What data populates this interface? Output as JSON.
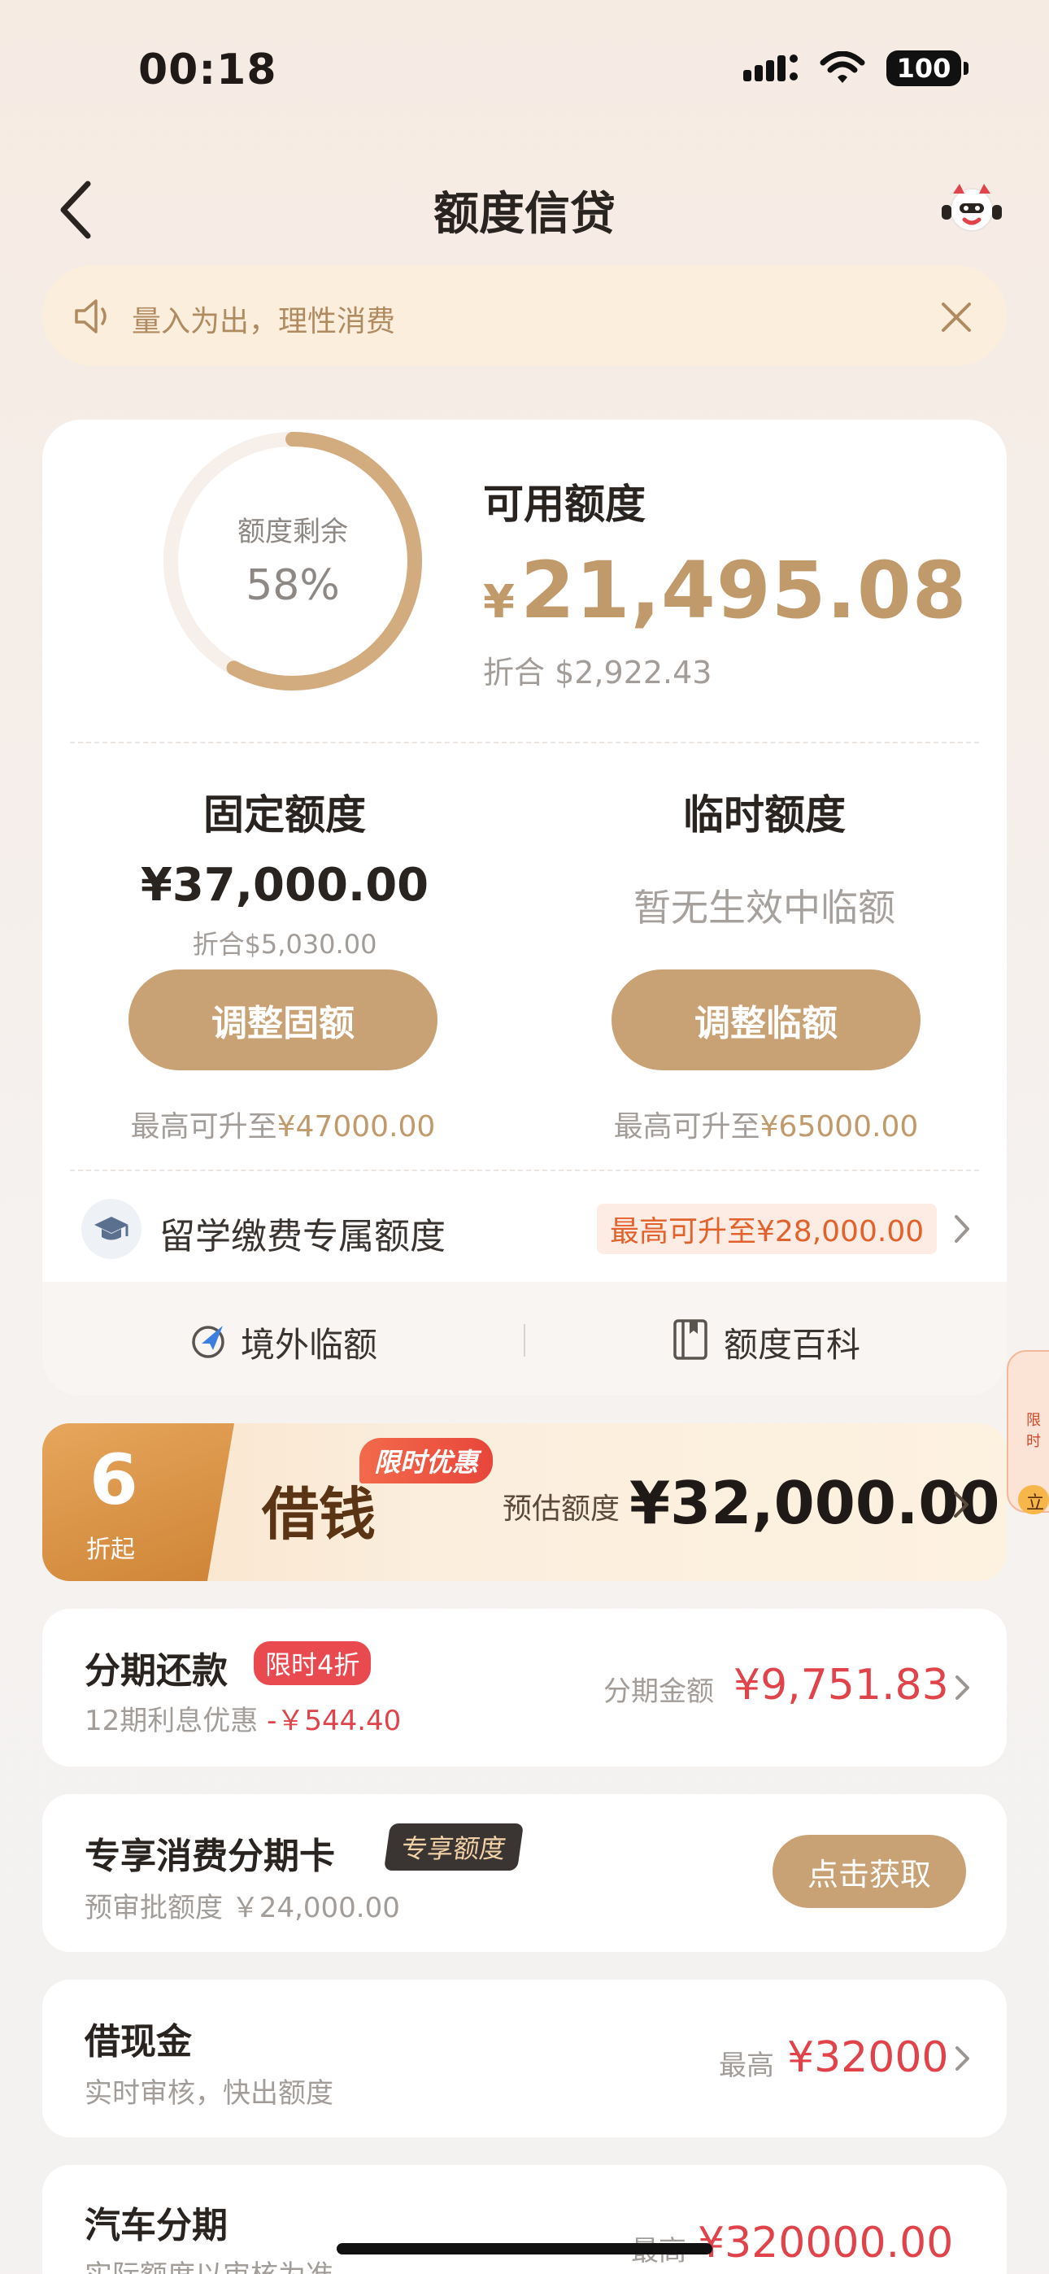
{
  "status_bar": {
    "time": "00:18",
    "battery": "100"
  },
  "nav": {
    "title": "额度信贷",
    "back_icon": "chevron-left-icon",
    "mascot_icon": "mascot-icon"
  },
  "notice": {
    "text": "量入为出，理性消费"
  },
  "credit": {
    "ring_label": "额度剩余",
    "ring_percent": "58%",
    "remaining_fraction": 0.58,
    "available_label": "可用额度",
    "available_currency": "¥",
    "available_amount": "21,495.08",
    "available_usd": "折合  $2,922.43"
  },
  "fixed": {
    "title": "固定额度",
    "amount": "¥37,000.00",
    "usd": "折合$5,030.00",
    "button": "调整固额",
    "max_label": "最高可升至",
    "max_value": "¥47000.00"
  },
  "temporary": {
    "title": "临时额度",
    "none_text": "暂无生效中临额",
    "button": "调整临额",
    "max_label": "最高可升至",
    "max_value": "¥65000.00"
  },
  "study": {
    "label": "留学缴费专属额度",
    "badge": "最高可升至¥28,000.00"
  },
  "links": {
    "overseas": "境外临额",
    "wiki": "额度百科"
  },
  "side_float": {
    "text": "限时",
    "tag": "立"
  },
  "loan": {
    "discount_number": "6",
    "discount_sub": "折起",
    "promo_tag": "限时优惠",
    "title": "借钱",
    "est_label": "预估额度",
    "est_value": "¥32,000.00"
  },
  "installment": {
    "title": "分期还款",
    "tag": "限时4折",
    "sub_prefix": "12期利息优惠",
    "sub_value": "-￥544.40",
    "right_label": "分期金额",
    "right_value": "¥9,751.83"
  },
  "exclusive_card": {
    "title": "专享消费分期卡",
    "tag": "专享额度",
    "sub": "预审批额度 ￥24,000.00",
    "button": "点击获取"
  },
  "cash": {
    "title": "借现金",
    "sub": "实时审核，快出额度",
    "right_label": "最高",
    "right_value": "¥32000"
  },
  "car": {
    "title": "汽车分期",
    "sub": "实际额度以审核为准",
    "right_label": "最高",
    "right_value": "¥320000.00"
  },
  "colors": {
    "gold": "#c8a274",
    "accent_red": "#e0434a",
    "amount_gold": "#c19a6b"
  }
}
